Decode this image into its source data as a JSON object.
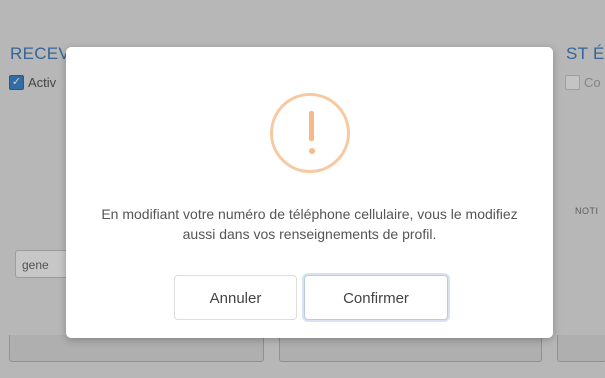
{
  "background": {
    "heading_partial": "RECEV",
    "heading_tail": "ST ÉM",
    "checkbox_left_label": "Activ",
    "checkbox_right_label": "Co",
    "input_left_value": "gene",
    "notification_label": "NOTI"
  },
  "modal": {
    "icon": "exclamation-warning-icon",
    "message": "En modifiant votre numéro de téléphone cellulaire, vous le modifiez aussi dans vos renseignements de profil.",
    "cancel_label": "Annuler",
    "confirm_label": "Confirmer"
  },
  "colors": {
    "accent_blue": "#2f6fb0",
    "warning_orange": "#f5b98b"
  }
}
